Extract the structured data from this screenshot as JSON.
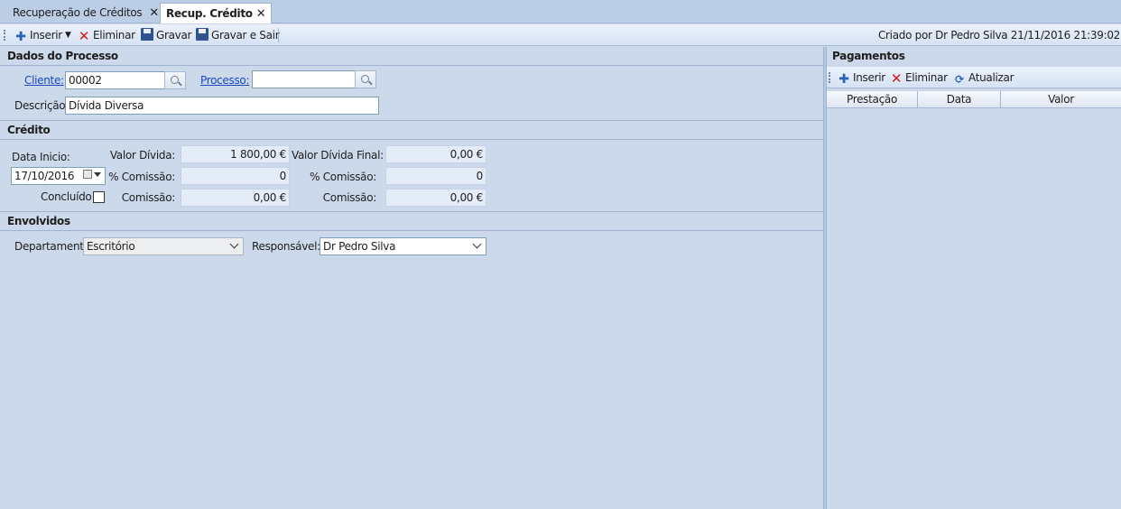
{
  "tabs": [
    {
      "label": "Recuperação de Créditos",
      "active": false
    },
    {
      "label": "Recup. Crédito",
      "active": true
    }
  ],
  "toolbar": {
    "insert_label": "Inserir",
    "delete_label": "Eliminar",
    "save_label": "Gravar",
    "save_exit_label": "Gravar e Sair",
    "created_by": "Criado por Dr Pedro Silva 21/11/2016 21:39:02"
  },
  "dados": {
    "title": "Dados do Processo",
    "cliente_label": "Cliente:",
    "cliente_value": "00002",
    "processo_label": "Processo:",
    "processo_value": "",
    "descricao_label": "Descrição:",
    "descricao_value": "Dívida Diversa"
  },
  "credito": {
    "title": "Crédito",
    "data_inicio_label": "Data Inicio:",
    "data_inicio_value": "17/10/2016",
    "concluido_label": "Concluído",
    "valor_divida_label": "Valor Dívida:",
    "valor_divida_value": "1 800,00 €",
    "pct_comissao_label": "% Comissão:",
    "pct_comissao_value": "0",
    "comissao_label": "Comissão:",
    "comissao_value": "0,00 €",
    "valor_final_label": "Valor Dívida Final:",
    "valor_final_value": "0,00 €",
    "pct_comissao2_label": "% Comissão:",
    "pct_comissao2_value": "0",
    "comissao2_label": "Comissão:",
    "comissao2_value": "0,00 €"
  },
  "envolvidos": {
    "title": "Envolvidos",
    "departamento_label": "Departamento:",
    "departamento_value": "Escritório",
    "responsavel_label": "Responsável:",
    "responsavel_value": "Dr Pedro Silva"
  },
  "pagamentos": {
    "title": "Pagamentos",
    "insert_label": "Inserir",
    "delete_label": "Eliminar",
    "refresh_label": "Atualizar",
    "columns": [
      "Prestação",
      "Data",
      "Valor"
    ]
  }
}
